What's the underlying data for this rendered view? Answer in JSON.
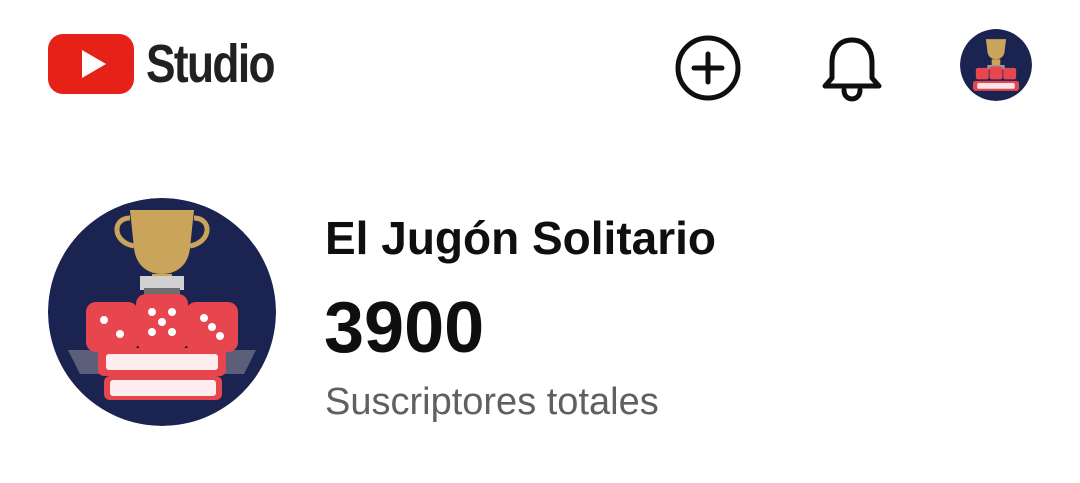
{
  "header": {
    "logo_text": "Studio",
    "logo_icon": "youtube-play-icon",
    "create_icon": "add-circle-icon",
    "notifications_icon": "bell-icon",
    "avatar_icon": "channel-avatar",
    "brand_color": "#ff0000"
  },
  "channel": {
    "name": "El Jugón Solitario",
    "subscriber_count": "3900",
    "subscriber_label": "Suscriptores totales",
    "avatar_icon": "channel-avatar",
    "avatar_colors": {
      "background": "#1b2450",
      "dice": "#e8464f",
      "trophy": "#c9a45a"
    }
  }
}
